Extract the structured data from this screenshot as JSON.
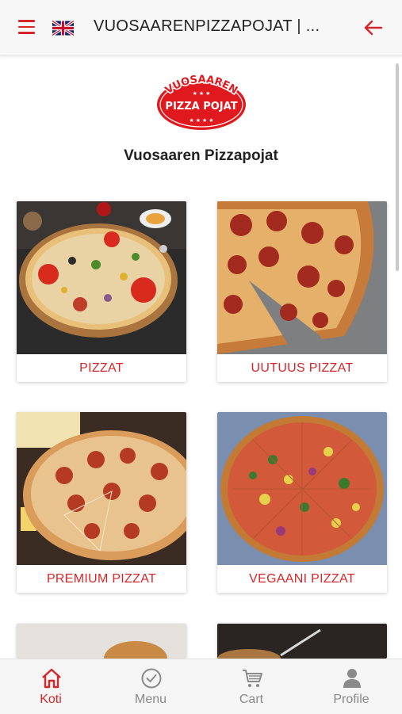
{
  "header": {
    "title": "VUOSAARENPIZZAPOJAT | ...",
    "menu_icon": "hamburger-menu-icon",
    "language_icon": "uk-flag-icon",
    "back_icon": "arrow-left-icon"
  },
  "logo": {
    "top_text": "VUOSAAREN",
    "main_text": "PIZZA POJAT"
  },
  "store": {
    "name": "Vuosaaren Pizzapojat"
  },
  "categories": [
    {
      "label": "PIZZAT"
    },
    {
      "label": "UUTUUS PIZZAT"
    },
    {
      "label": "PREMIUM PIZZAT"
    },
    {
      "label": "VEGAANI PIZZAT"
    }
  ],
  "bottom_nav": [
    {
      "label": "Koti",
      "icon": "home-icon",
      "active": true
    },
    {
      "label": "Menu",
      "icon": "check-circle-icon",
      "active": false
    },
    {
      "label": "Cart",
      "icon": "cart-icon",
      "active": false
    },
    {
      "label": "Profile",
      "icon": "person-icon",
      "active": false
    }
  ],
  "colors": {
    "accent": "#d6262a",
    "inactive": "#8a8a8a",
    "header_bg": "#f7f7f7"
  }
}
